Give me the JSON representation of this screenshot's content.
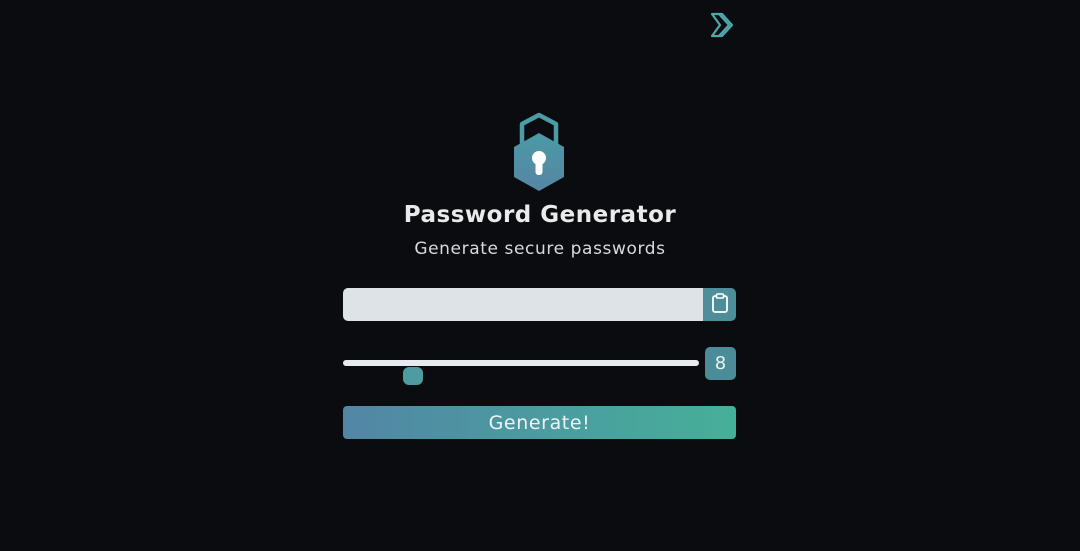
{
  "app": {
    "title": "Password Generator",
    "subtitle": "Generate secure passwords"
  },
  "icons": {
    "header_logo": "chevron-logo-icon",
    "hero": "lock-icon",
    "copy": "clipboard-icon"
  },
  "password": {
    "value": "",
    "placeholder": ""
  },
  "length": {
    "value": 8,
    "min": 4,
    "max": 64
  },
  "generate_button": {
    "label": "Generate!"
  },
  "colors": {
    "background": "#0a0c0f",
    "accent": "#4d8e9a",
    "gradient_start": "#5286a6",
    "gradient_end": "#45b099",
    "field": "#dde3e7"
  }
}
